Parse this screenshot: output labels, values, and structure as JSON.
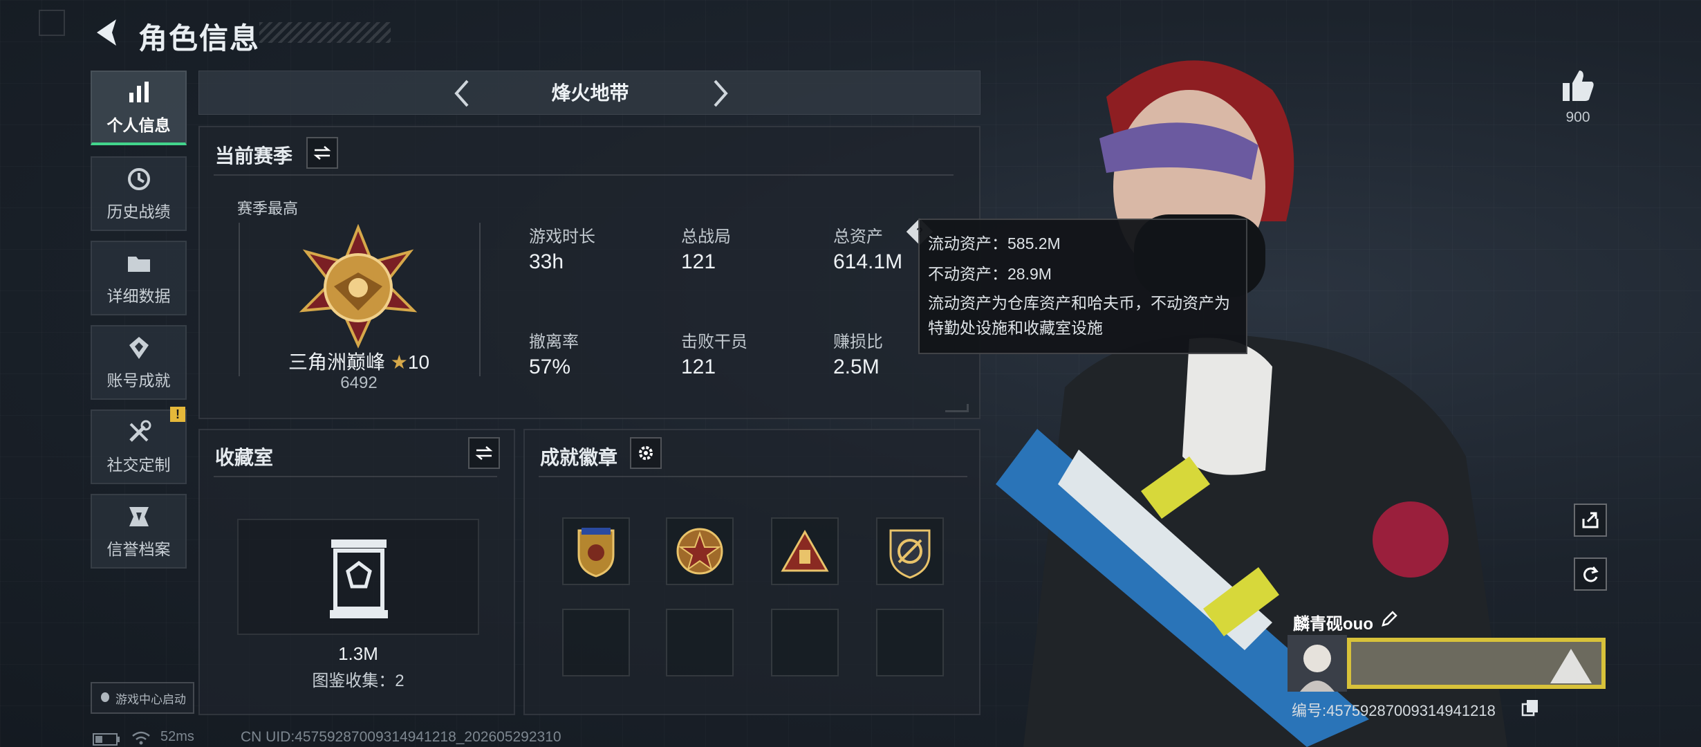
{
  "header": {
    "title": "角色信息"
  },
  "sidebar": {
    "items": [
      {
        "label": "个人信息",
        "icon": "bar-chart-icon",
        "active": true
      },
      {
        "label": "历史战绩",
        "icon": "history-icon"
      },
      {
        "label": "详细数据",
        "icon": "folder-icon"
      },
      {
        "label": "账号成就",
        "icon": "achievement-icon"
      },
      {
        "label": "社交定制",
        "icon": "tools-icon",
        "notice": "!"
      },
      {
        "label": "信誉档案",
        "icon": "credit-icon"
      }
    ],
    "launch_label": "游戏中心启动"
  },
  "mode": {
    "title": "烽火地带"
  },
  "season": {
    "title": "当前赛季",
    "best_label": "赛季最高",
    "rank_name": "三角洲巅峰",
    "rank_stars": "10",
    "rank_points": "6492",
    "stats": [
      {
        "label": "游戏时长",
        "value": "33h"
      },
      {
        "label": "总战局",
        "value": "121"
      },
      {
        "label": "总资产",
        "value": "614.1M"
      },
      {
        "label": "撤离率",
        "value": "57%"
      },
      {
        "label": "击败干员",
        "value": "121"
      },
      {
        "label": "赚损比",
        "value": "2.5M"
      }
    ]
  },
  "tooltip": {
    "line1": "流动资产：585.2M",
    "line2": "不动资产：28.9M",
    "note": "流动资产为仓库资产和哈夫币，不动资产为特勤处设施和收藏室设施"
  },
  "collection": {
    "title": "收藏室",
    "value": "1.3M",
    "catalog": "图鉴收集：2"
  },
  "badges": {
    "title": "成就徽章",
    "items": [
      "badge-shield-icon",
      "badge-star-icon",
      "badge-triangle-icon",
      "badge-emblem-icon"
    ]
  },
  "likes": {
    "count": "900"
  },
  "player": {
    "name": "麟青砚ouo",
    "id": "编号:4575928700931494121​8"
  },
  "status": {
    "ping": "52ms",
    "uid": "CN UID:4575928700931494121​8_202605292310"
  },
  "colors": {
    "accent": "#42d58c",
    "notice": "#e5b83a",
    "gold": "#d6a84a"
  }
}
